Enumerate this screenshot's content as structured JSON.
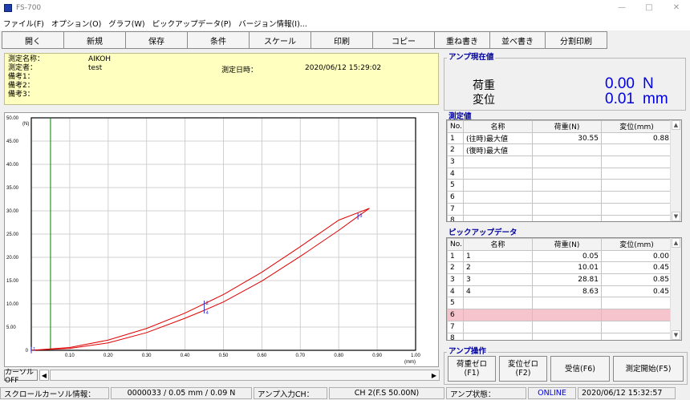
{
  "window": {
    "title": "FS-700",
    "minimize": "—",
    "maximize": "□",
    "close": "✕"
  },
  "menu": [
    "ファイル(F)",
    "オプション(O)",
    "グラフ(W)",
    "ピックアップデータ(P)",
    "バージョン情報(I)..."
  ],
  "toolbar": [
    "開く",
    "新規",
    "保存",
    "条件",
    "スケール",
    "印刷",
    "コピー",
    "重ね書き",
    "並べ書き",
    "分割印刷"
  ],
  "info": {
    "name_label": "測定名称：",
    "name_value": "AIKOH",
    "operator_label": "測定者：",
    "operator_value": "test",
    "date_label": "測定日時：",
    "date_value": "2020/06/12 15:29:02",
    "note1": "備考1：",
    "note2": "備考2：",
    "note3": "備考3："
  },
  "amp_now": {
    "title": "アンプ現在値",
    "load_label": "荷重",
    "load_value": "0.00",
    "load_unit": "N",
    "disp_label": "変位",
    "disp_value": "0.01",
    "disp_unit": "mm"
  },
  "measured": {
    "title": "測定値",
    "headers": [
      "No.",
      "名称",
      "荷重(N)",
      "変位(mm)"
    ],
    "rows": [
      [
        "1",
        "(往時)最大値",
        "30.55",
        "0.88"
      ],
      [
        "2",
        "(復時)最大値",
        "",
        ""
      ],
      [
        "3",
        "",
        "",
        ""
      ],
      [
        "4",
        "",
        "",
        ""
      ],
      [
        "5",
        "",
        "",
        ""
      ],
      [
        "6",
        "",
        "",
        ""
      ],
      [
        "7",
        "",
        "",
        ""
      ],
      [
        "8",
        "",
        "",
        ""
      ]
    ]
  },
  "pickup": {
    "title": "ピックアップデータ",
    "headers": [
      "No.",
      "名称",
      "荷重(N)",
      "変位(mm)"
    ],
    "rows": [
      [
        "1",
        "1",
        "0.05",
        "0.00"
      ],
      [
        "2",
        "2",
        "10.01",
        "0.45"
      ],
      [
        "3",
        "3",
        "28.81",
        "0.85"
      ],
      [
        "4",
        "4",
        "8.63",
        "0.45"
      ],
      [
        "5",
        "",
        "",
        ""
      ],
      [
        "6",
        "",
        "",
        ""
      ],
      [
        "7",
        "",
        "",
        ""
      ],
      [
        "8",
        "",
        "",
        ""
      ]
    ],
    "highlight_row": 6,
    "highlight_color": "#f6c4cc"
  },
  "amp_ops": {
    "title": "アンプ操作",
    "buttons": [
      "荷重ゼロ\n(F1)",
      "変位ゼロ\n(F2)",
      "受信(F6)",
      "測定開始(F5)"
    ]
  },
  "cursor_btn": "カーソル OFF",
  "status": {
    "scroll_label": "スクロールカーソル情報：",
    "scroll_value": "0000033 / 0.05 mm / 0.09 N",
    "amp_ch_label": "アンプ入力CH：",
    "amp_ch_value": "CH 2(F.S 50.00N)",
    "amp_state_label": "アンプ状態：",
    "amp_state_value": "ONLINE",
    "datetime": "2020/06/12 15:32:57"
  },
  "chart_data": {
    "type": "line",
    "xlabel": "(mm)",
    "ylabel": "(N)",
    "xlim": [
      0,
      1.0
    ],
    "ylim": [
      0,
      50
    ],
    "xticks": [
      "0.10",
      "0.20",
      "0.30",
      "0.40",
      "0.50",
      "0.60",
      "0.70",
      "0.80",
      "0.90",
      "1.00"
    ],
    "yticks": [
      "5.00",
      "10.00",
      "15.00",
      "20.00",
      "25.00",
      "30.00",
      "35.00",
      "40.00",
      "45.00",
      "50.00"
    ],
    "origin_label": "0",
    "series": [
      {
        "x": [
          0.0,
          0.1,
          0.2,
          0.3,
          0.4,
          0.45,
          0.5,
          0.6,
          0.7,
          0.8,
          0.88
        ],
        "y": [
          0.0,
          0.6,
          2.2,
          4.7,
          8.0,
          10.0,
          12.0,
          16.8,
          22.3,
          28.0,
          30.55
        ],
        "color": "#e00000"
      },
      {
        "x": [
          0.0,
          0.1,
          0.2,
          0.3,
          0.4,
          0.45,
          0.5,
          0.6,
          0.7,
          0.8,
          0.85,
          0.88
        ],
        "y": [
          0.0,
          0.4,
          1.6,
          3.8,
          6.9,
          8.6,
          10.4,
          14.9,
          20.2,
          25.8,
          28.8,
          30.55
        ],
        "color": "#e00000"
      }
    ],
    "cursor_x": 0.05,
    "cursor_color": "#008000",
    "pickups": [
      {
        "label": "1",
        "x": 0.0,
        "y": 0.05
      },
      {
        "label": "2",
        "x": 0.45,
        "y": 10.01
      },
      {
        "label": "3",
        "x": 0.85,
        "y": 28.81
      },
      {
        "label": "4",
        "x": 0.45,
        "y": 8.63
      }
    ]
  }
}
